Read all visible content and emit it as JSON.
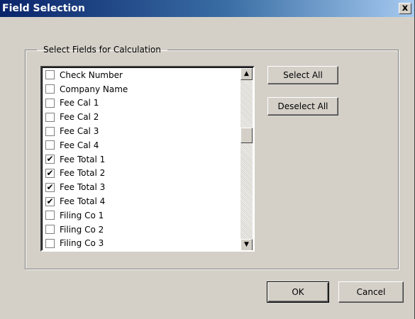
{
  "window": {
    "title": "Field Selection",
    "close_glyph": "x"
  },
  "group": {
    "legend": "Select Fields for Calculation"
  },
  "fields": [
    {
      "label": "Check Number",
      "checked": false
    },
    {
      "label": "Company Name",
      "checked": false
    },
    {
      "label": "Fee Cal 1",
      "checked": false
    },
    {
      "label": "Fee Cal 2",
      "checked": false
    },
    {
      "label": "Fee Cal 3",
      "checked": false
    },
    {
      "label": "Fee Cal 4",
      "checked": false
    },
    {
      "label": "Fee Total 1",
      "checked": true
    },
    {
      "label": "Fee Total 2",
      "checked": true
    },
    {
      "label": "Fee Total 3",
      "checked": true
    },
    {
      "label": "Fee Total 4",
      "checked": true
    },
    {
      "label": "Filing Co 1",
      "checked": false
    },
    {
      "label": "Filing Co 2",
      "checked": false
    },
    {
      "label": "Filing Co 3",
      "checked": false
    }
  ],
  "buttons": {
    "select_all": "Select All",
    "deselect_all": "Deselect All",
    "ok": "OK",
    "cancel": "Cancel"
  },
  "icons": {
    "checkmark": "✔",
    "scroll_up": "▲",
    "scroll_down": "▼"
  },
  "colors": {
    "titlebar_start": "#0a246a",
    "titlebar_end": "#a6caf0",
    "face": "#d4d0c8"
  }
}
